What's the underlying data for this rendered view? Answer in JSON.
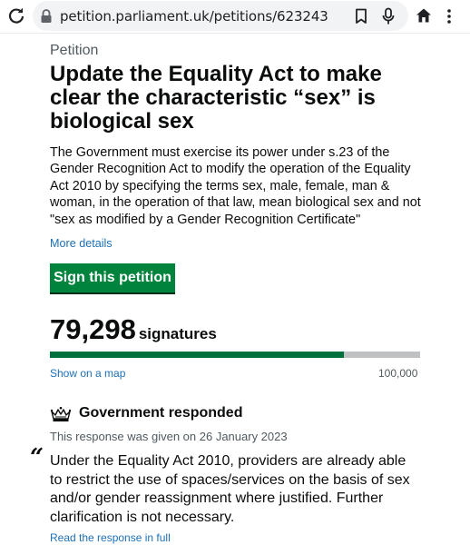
{
  "browser": {
    "url": "petition.parliament.uk/petitions/623243",
    "icons": [
      "reload-icon",
      "lock-icon",
      "bookmark-icon",
      "mic-icon",
      "home-icon",
      "menu-icon"
    ]
  },
  "petition": {
    "kicker": "Petition",
    "title": "Update the Equality Act to make clear the characteristic “sex” is biological sex",
    "summary": "The Government must exercise its power under s.23 of the Gender Recognition Act to modify the operation of the Equality Act 2010 by specifying the terms sex, male, female, man & woman, in the operation of that law, mean biological sex and not \"sex as modified by a Gender Recognition Certificate\"",
    "more_details": "More details",
    "sign_button": "Sign this petition"
  },
  "signatures": {
    "count": "79,298",
    "label": "signatures",
    "progress_fraction": 0.793,
    "map_link": "Show on a map",
    "target": "100,000"
  },
  "response": {
    "heading": "Government responded",
    "given": "This response was given on 26 January 2023",
    "quote_mark": "“",
    "text": "Under the Equality Act 2010, providers are already able to restrict the use of spaces/services on the basis of sex and/or gender reassignment where justified. Further clarification is not necessary.",
    "read_full": "Read the response in full"
  },
  "colors": {
    "button_green": "#00843d",
    "progress_green": "#00703c",
    "link_blue": "#1d70b8",
    "secondary_text": "#505a5f"
  }
}
